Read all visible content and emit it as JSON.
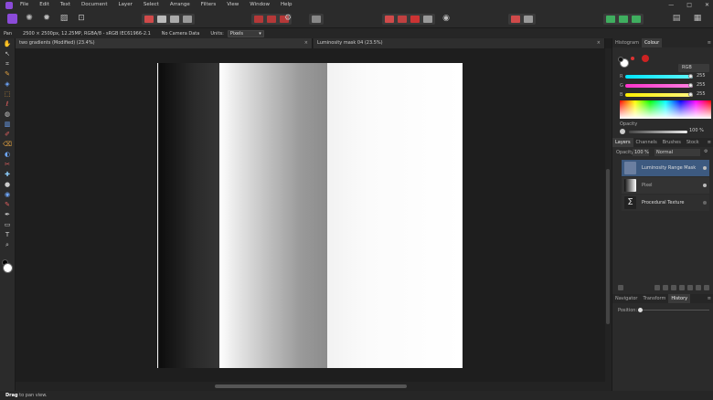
{
  "app": {
    "name": "Affinity Photo",
    "accent": "#8b4bd8"
  },
  "menu": [
    "File",
    "Edit",
    "Text",
    "Document",
    "Layer",
    "Select",
    "Arrange",
    "Filters",
    "View",
    "Window",
    "Help"
  ],
  "window_controls": {
    "minimize": "—",
    "maximize": "□",
    "close": "✕"
  },
  "context": {
    "tool": "Pan",
    "doc_info": "2500 × 2500px, 12.25MP, RGBA/8 - sRGB IEC61966-2.1",
    "camera": "No Camera Data",
    "units_label": "Units:",
    "units_value": "Pixels"
  },
  "tabs": [
    {
      "label": "two gradients (Modified) (23.4%)",
      "close": "×"
    },
    {
      "label": "Luminosity mask 04 (23.5%)",
      "close": "×"
    }
  ],
  "panel": {
    "top_tabs": [
      "Histogram",
      "Colour"
    ],
    "colour_mode": "RGB",
    "sliders": [
      {
        "channel": "R",
        "value": "255",
        "color": "#00e5ff"
      },
      {
        "channel": "G",
        "value": "255",
        "color": "#ff33cc"
      },
      {
        "channel": "B",
        "value": "255",
        "color": "#ffee00"
      }
    ],
    "opacity_label": "Opacity",
    "opacity_value": "100 %",
    "layer_tabs": [
      "Layers",
      "Channels",
      "Brushes",
      "Stock"
    ],
    "layer_opacity_label": "Opacity:",
    "layer_opacity": "100 %",
    "blend_mode": "Normal",
    "layers": [
      {
        "name": "Luminosity Range Mask",
        "selected": true
      },
      {
        "name": "Pixel",
        "selected": false
      },
      {
        "name": "Procedural Texture",
        "selected": false
      }
    ],
    "bottom_tabs": [
      "Navigator",
      "Transform",
      "History"
    ],
    "history_label": "Position:"
  },
  "status": {
    "bold": "Drag",
    "text": " to pan view."
  }
}
